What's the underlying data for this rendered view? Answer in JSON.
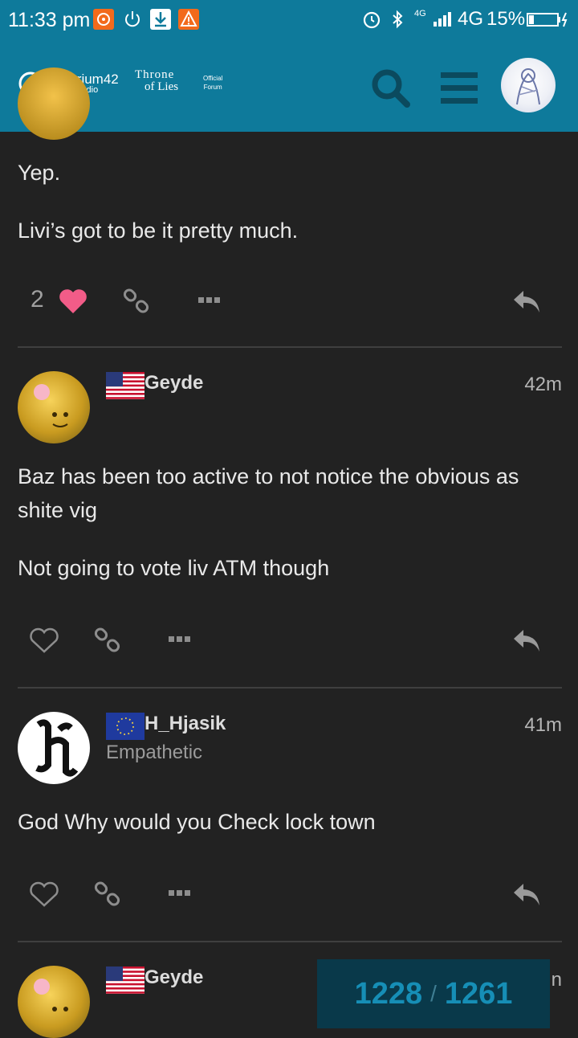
{
  "status_bar": {
    "time": "11:33 pm",
    "network_small": "4G",
    "network": "4G",
    "battery": "15%"
  },
  "header": {
    "brand_name": "Imperium42",
    "brand_sub": "Game Studio",
    "forum_logo_line1": "Throne",
    "forum_logo_line2": "of Lies",
    "forum_tag_line1": "Official",
    "forum_tag_line2": "Forum",
    "accent": "#0e7a9b"
  },
  "posts": [
    {
      "paragraphs": [
        "Yep.",
        "Livi’s got to be it pretty much."
      ],
      "likes": "2"
    },
    {
      "username": "Geyde",
      "time": "42m",
      "paragraphs": [
        "Baz has been too active to not notice the obvious as shite vig",
        "Not going to vote liv ATM though"
      ]
    },
    {
      "username": "H_Hjasik",
      "title": "Empathetic",
      "time": "41m",
      "paragraphs": [
        "God Why would you Check lock town"
      ]
    },
    {
      "username": "Geyde",
      "time_partial": "n"
    }
  ],
  "progress": {
    "current": "1228",
    "separator": "/",
    "total": "1261"
  }
}
